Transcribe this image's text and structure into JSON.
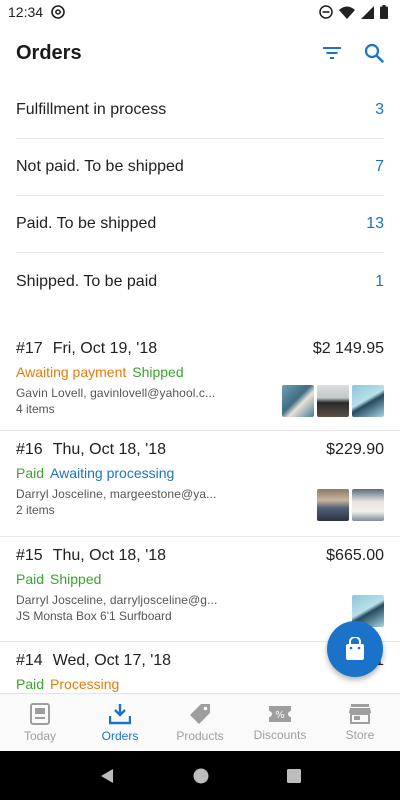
{
  "status_bar": {
    "time": "12:34"
  },
  "app_bar": {
    "title": "Orders",
    "icons": [
      "filter-icon",
      "search-icon"
    ]
  },
  "summary": [
    {
      "label": "Fulfillment in process",
      "count": "3"
    },
    {
      "label": "Not paid. To be shipped",
      "count": "7"
    },
    {
      "label": "Paid. To be shipped",
      "count": "13"
    },
    {
      "label": "Shipped. To be paid",
      "count": "1"
    }
  ],
  "orders": [
    {
      "number": "#17",
      "date": "Fri, Oct 19, '18",
      "total": "$2 149.95",
      "tag1": "Awaiting payment",
      "tag2": "Shipped",
      "customer": "Gavin Lovell, gavinlovell@yahool.c...",
      "items": "4 items"
    },
    {
      "number": "#16",
      "date": "Thu, Oct 18, '18",
      "total": "$229.90",
      "tag1": "Paid",
      "tag2": "Awaiting processing",
      "customer": "Darryl Josceline, margeestone@ya...",
      "items": "2 items"
    },
    {
      "number": "#15",
      "date": "Thu, Oct 18, '18",
      "total": "$665.00",
      "tag1": "Paid",
      "tag2": "Shipped",
      "customer": "Darryl Josceline, darryljosceline@g...",
      "items": "JS Monsta Box 6'1 Surfboard"
    },
    {
      "number": "#14",
      "date": "Wed, Oct 17, '18",
      "total": "$1",
      "tag1": "Paid",
      "tag2": "Processing",
      "customer": "",
      "items": ""
    }
  ],
  "bottom_nav": [
    {
      "label": "Today",
      "icon": "today-icon"
    },
    {
      "label": "Orders",
      "icon": "orders-icon",
      "active": true
    },
    {
      "label": "Products",
      "icon": "tag-icon"
    },
    {
      "label": "Discounts",
      "icon": "discount-icon"
    },
    {
      "label": "Store",
      "icon": "store-icon"
    }
  ],
  "colors": {
    "accent": "#1a73c9",
    "orange": "#e8790a",
    "green": "#3aa42f"
  }
}
